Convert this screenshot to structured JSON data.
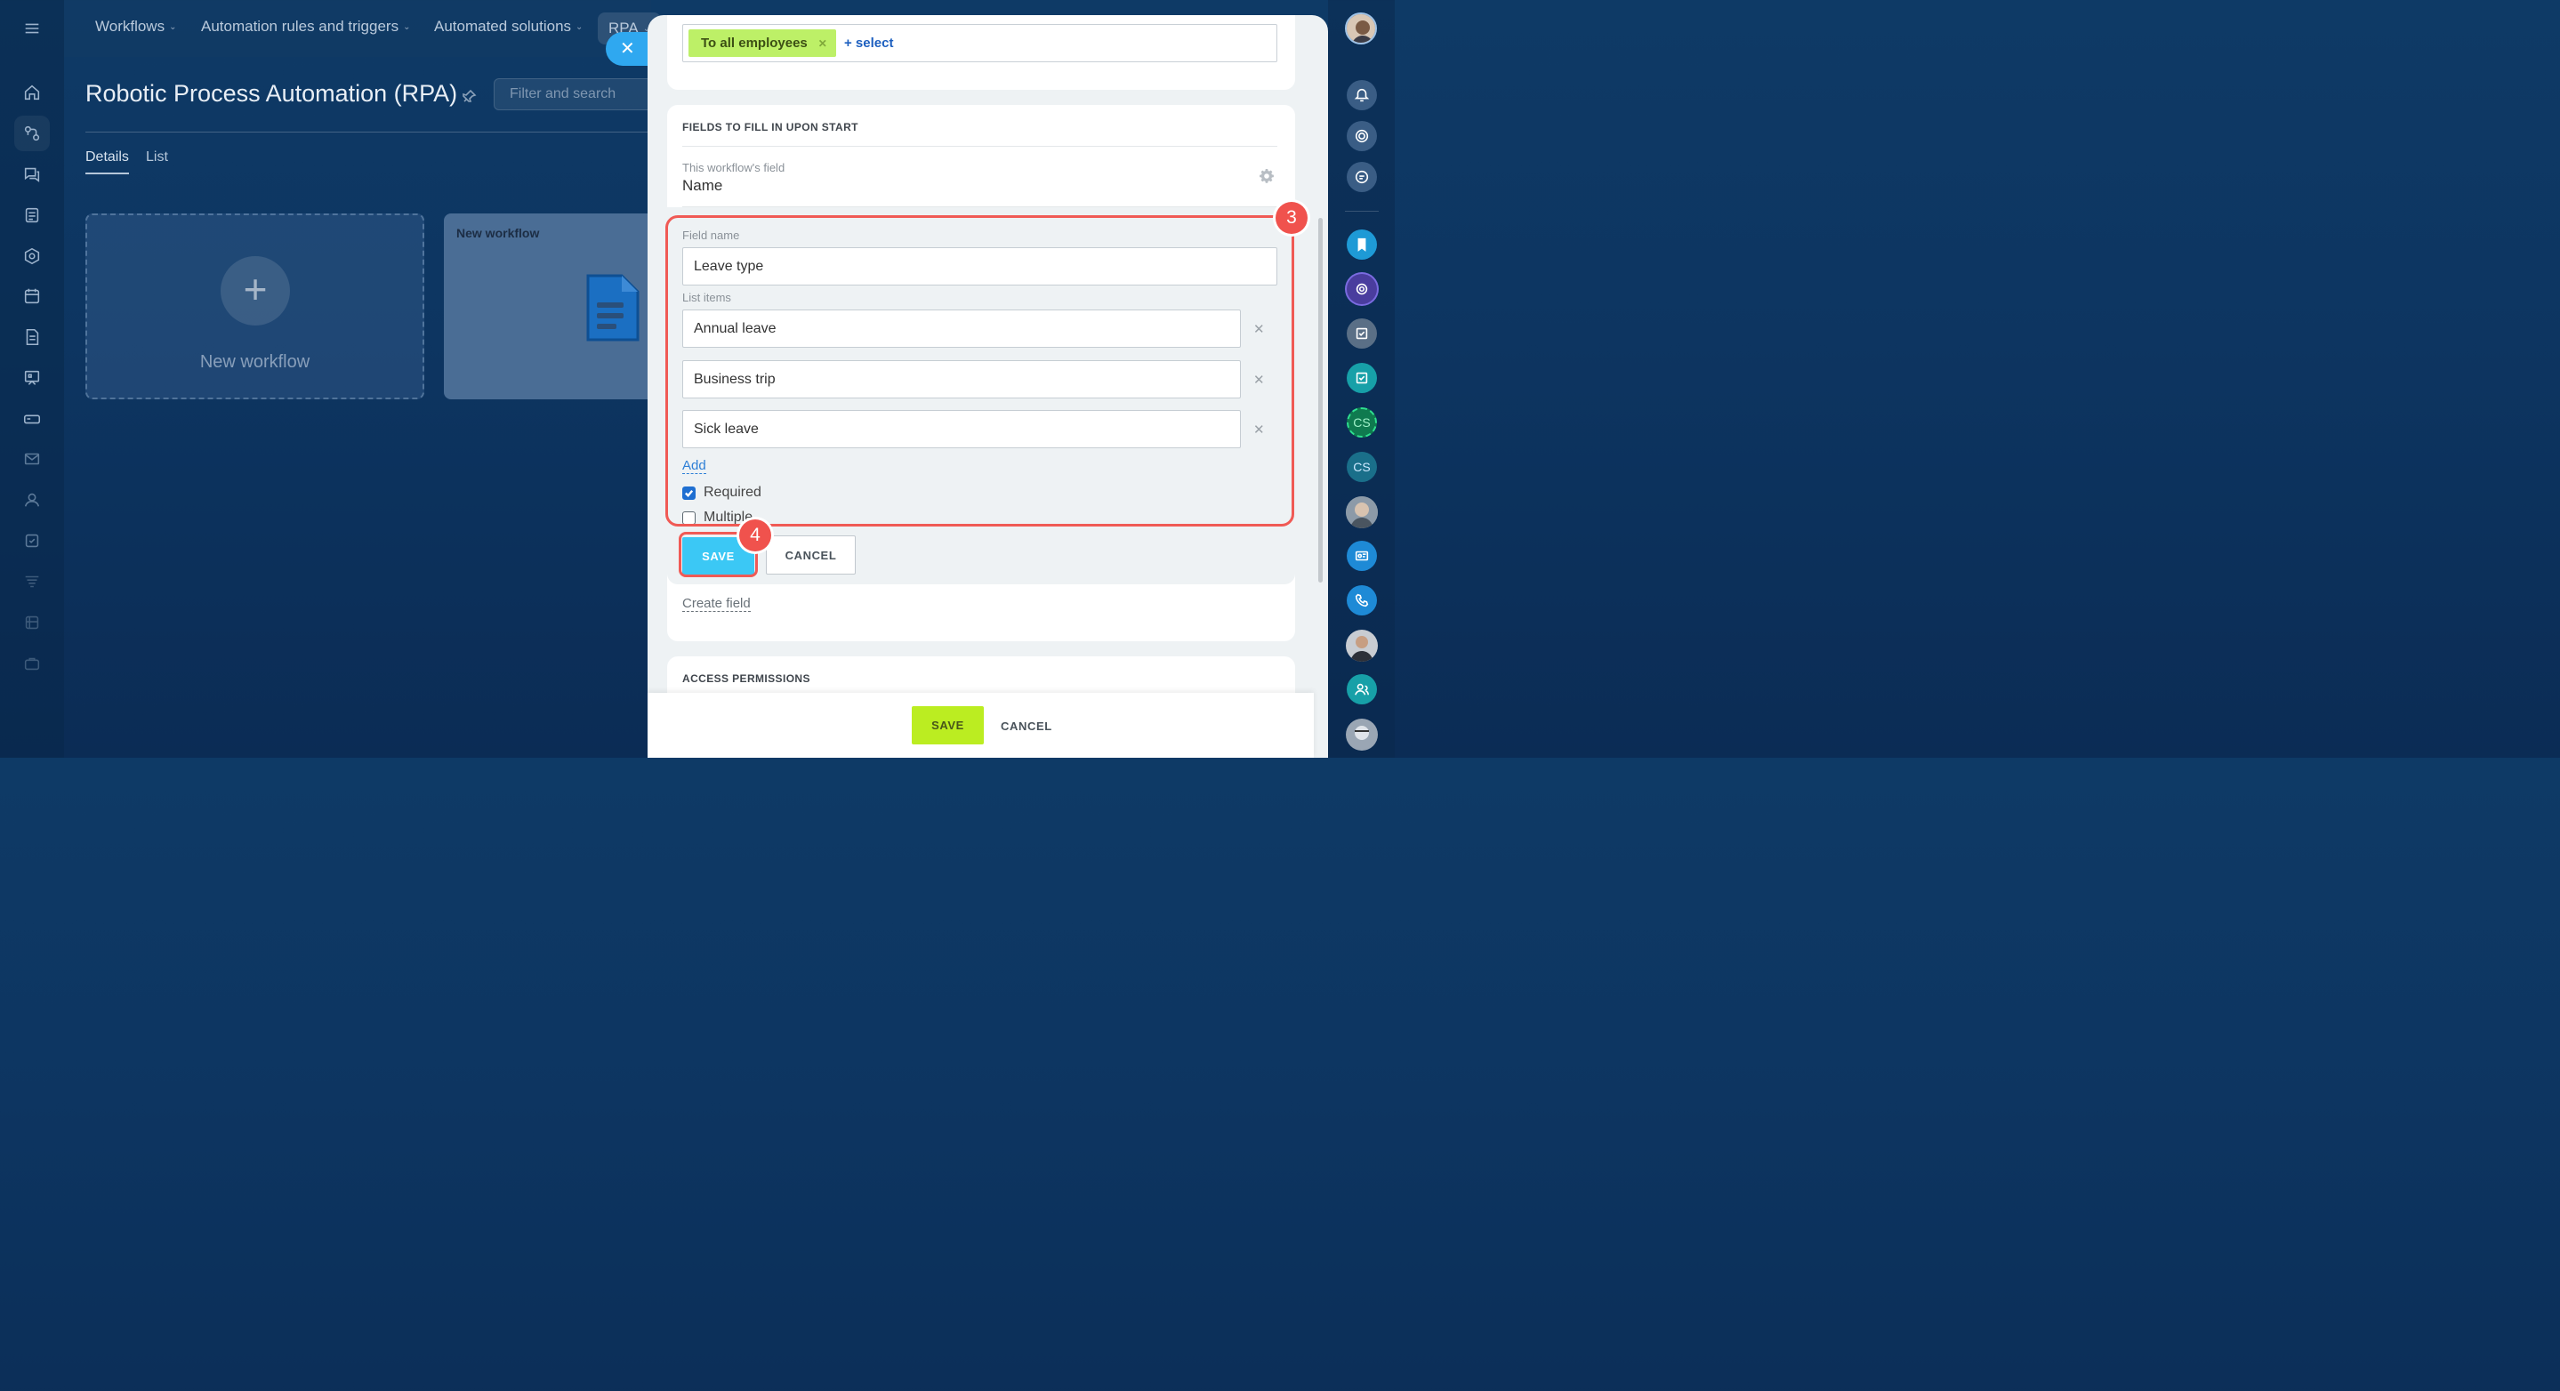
{
  "nav": {
    "items": [
      {
        "label": "Workflows"
      },
      {
        "label": "Automation rules and triggers"
      },
      {
        "label": "Automated solutions"
      },
      {
        "label": "RPA"
      }
    ]
  },
  "page": {
    "title": "Robotic Process Automation (RPA)",
    "filter_placeholder": "Filter and search",
    "tabs": [
      "Details",
      "List"
    ]
  },
  "cards": {
    "new_label": "New workflow",
    "workflow_title": "New workflow"
  },
  "panel": {
    "employees_tag": "To all employees",
    "select_link": "+ select",
    "fields_heading": "FIELDS TO FILL IN UPON START",
    "workflow_field_label": "This workflow's field",
    "workflow_field_value": "Name",
    "field_name_label": "Field name",
    "field_name_value": "Leave type",
    "list_items_label": "List items",
    "list_items": [
      "Annual leave",
      "Business trip",
      "Sick leave"
    ],
    "add_link": "Add",
    "required_label": "Required",
    "required_checked": true,
    "multiple_label": "Multiple",
    "multiple_checked": false,
    "save_label": "SAVE",
    "cancel_label": "CANCEL",
    "create_field_link": "Create field",
    "access_heading": "ACCESS PERMISSIONS",
    "footer_save": "SAVE",
    "footer_cancel": "CANCEL"
  },
  "annotations": {
    "badge_fields": "3",
    "badge_save": "4",
    "highlight_color": "#f05a55"
  },
  "right_rail": {
    "cs_label_1": "CS",
    "cs_label_2": "CS"
  },
  "colors": {
    "accent_blue": "#3bc8f5",
    "save_green": "#bbed21",
    "tag_green": "#bdf067",
    "link_blue": "#2d7fd6"
  }
}
